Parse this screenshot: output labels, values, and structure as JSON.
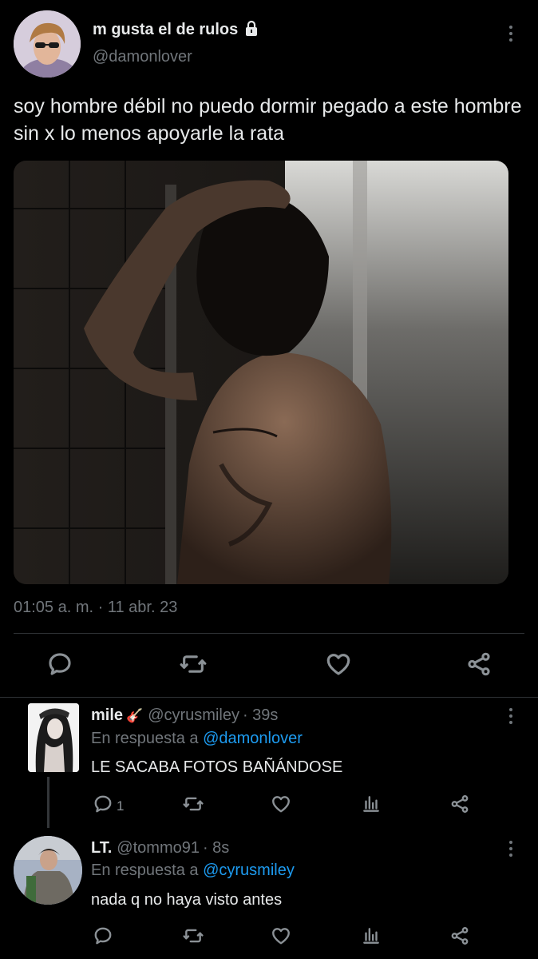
{
  "tweet": {
    "display_name": "m gusta el de rulos",
    "handle": "@damonlover",
    "text": "soy hombre débil no puedo dormir pegado a este hombre sin x lo menos apoyarle la rata",
    "timestamp": "01:05 a. m. · 11 abr. 23",
    "icons": [
      "lock-icon",
      "more-icon",
      "reply-icon",
      "retweet-icon",
      "like-icon",
      "share-icon"
    ]
  },
  "replies": [
    {
      "display_name": "mile",
      "emoji": "🎸",
      "handle": "@cyrusmiley",
      "time": "· 39s",
      "reply_prefix": "En respuesta a",
      "reply_to": "@damonlover",
      "text": "LE SACABA FOTOS BAÑÁNDOSE",
      "reply_count": "1"
    },
    {
      "display_name": "LT.",
      "handle": "@tommo91",
      "time": "· 8s",
      "reply_prefix": "En respuesta a",
      "reply_to": "@cyrusmiley",
      "text": "nada q no haya visto antes",
      "reply_count": ""
    }
  ],
  "colors": {
    "background": "#000000",
    "text": "#e7e9ea",
    "muted": "#71767b",
    "link": "#1d9bf0",
    "divider": "#2f3336"
  }
}
